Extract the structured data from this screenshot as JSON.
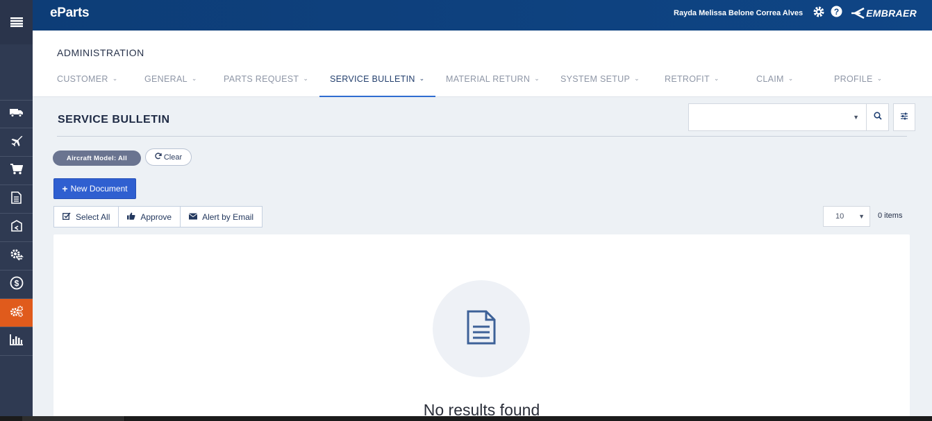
{
  "header": {
    "brand": "eParts",
    "user_name": "Rayda Melissa Belone Correa Alves",
    "logo": "EMBRAER"
  },
  "sidebar": {
    "items": [
      {
        "icon": "truck-icon"
      },
      {
        "icon": "airplane-icon"
      },
      {
        "icon": "cart-icon"
      },
      {
        "icon": "document-icon"
      },
      {
        "icon": "box-return-icon"
      },
      {
        "icon": "gear-exchange-icon"
      },
      {
        "icon": "money-icon"
      },
      {
        "icon": "cogs-icon",
        "active": true
      },
      {
        "icon": "bar-chart-icon"
      }
    ]
  },
  "admin": {
    "title": "ADMINISTRATION",
    "tabs": [
      {
        "label": "CUSTOMER"
      },
      {
        "label": "GENERAL"
      },
      {
        "label": "PARTS REQUEST"
      },
      {
        "label": "SERVICE BULLETIN",
        "active": true
      },
      {
        "label": "MATERIAL RETURN"
      },
      {
        "label": "SYSTEM SETUP"
      },
      {
        "label": "RETROFIT"
      },
      {
        "label": "CLAIM"
      },
      {
        "label": "PROFILE"
      }
    ]
  },
  "section": {
    "title": "SERVICE BULLETIN",
    "search_value": ""
  },
  "filters": {
    "chip": "Aircraft Model: All",
    "clear_label": "Clear"
  },
  "actions": {
    "new_document": "New Document",
    "select_all": "Select All",
    "approve": "Approve",
    "alert_by_email": "Alert by Email"
  },
  "pager": {
    "page_size": "10",
    "items_count": "0 items"
  },
  "results": {
    "empty_message": "No results found"
  },
  "colors": {
    "header": "#0d3f7a",
    "sidebar": "#2f3a52",
    "active_sidebar": "#e05b1c",
    "primary_button": "#2f5fd0",
    "active_tab_underline": "#2e6cd0"
  }
}
